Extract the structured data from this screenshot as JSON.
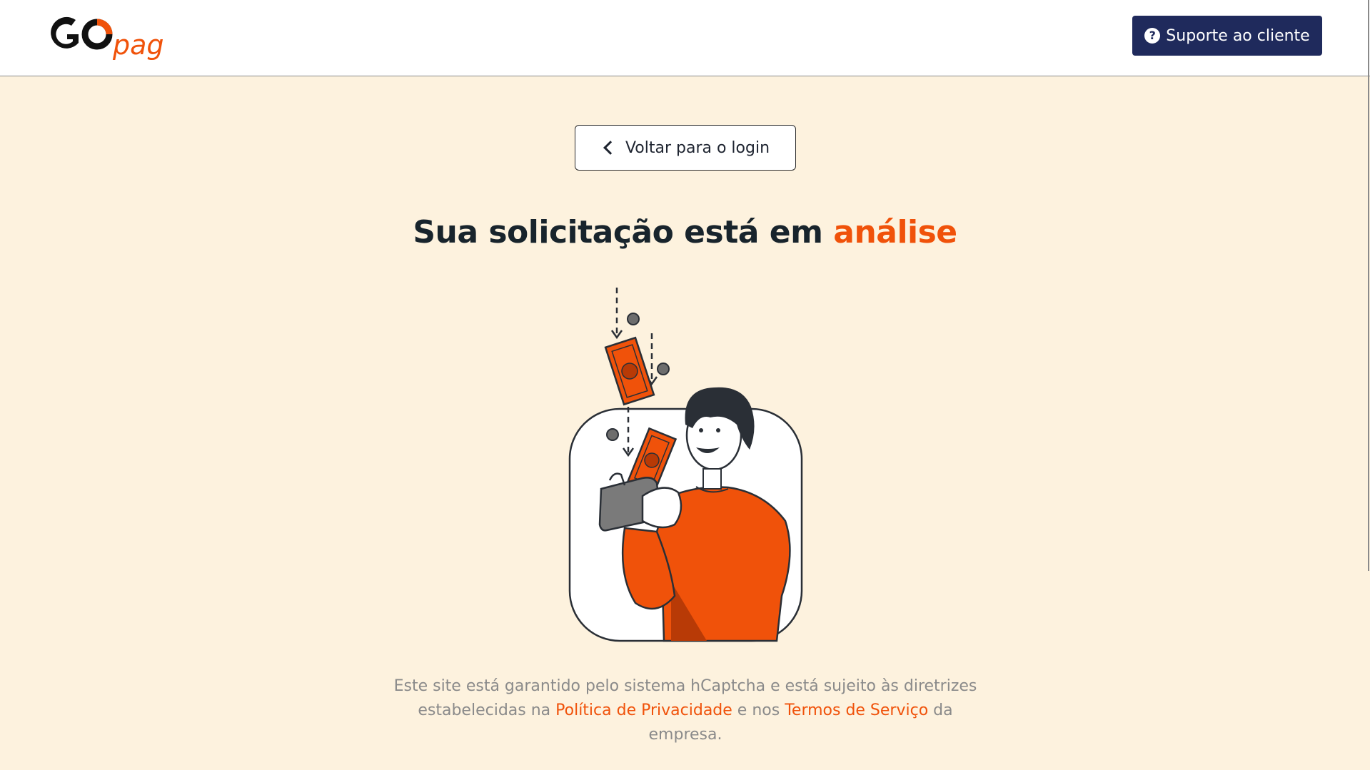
{
  "header": {
    "logo": {
      "text_go": "GO",
      "text_pag": "pag"
    },
    "support_button": {
      "label": "Suporte ao cliente",
      "icon": "question-circle-icon"
    }
  },
  "main": {
    "back_button": {
      "label": "Voltar para o login",
      "icon": "chevron-left-icon"
    },
    "title": {
      "prefix": "Sua solicitação está em ",
      "highlight": "análise"
    },
    "illustration": {
      "description_icon": "money-wallet-illustration"
    },
    "footer": {
      "text_before": "Este site está garantido pelo sistema hCaptcha e está sujeito às diretrizes estabelecidas na ",
      "privacy_link": "Política de Privacidade",
      "text_middle": " e nos ",
      "terms_link": "Termos de Serviço",
      "text_after": " da empresa."
    }
  },
  "colors": {
    "accent": "#f0520a",
    "navy": "#1f2a5c",
    "background": "#fdf2de",
    "dark_text": "#18242c",
    "muted_text": "#8a8a8a"
  }
}
